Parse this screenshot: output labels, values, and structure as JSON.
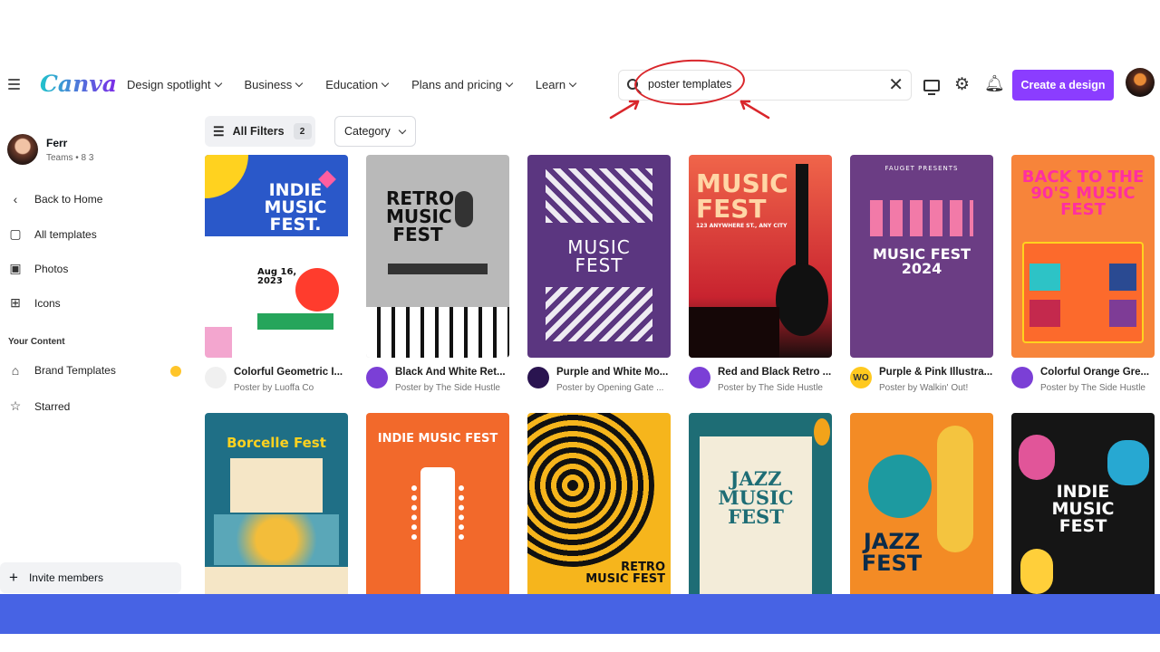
{
  "app": {
    "logo": "Canva"
  },
  "nav": [
    "Design spotlight",
    "Business",
    "Education",
    "Plans and pricing",
    "Learn"
  ],
  "search": {
    "value": "poster templates"
  },
  "header": {
    "create_label": "Create a design"
  },
  "user": {
    "name": "Ferr",
    "subtitle": "Teams • 8 3"
  },
  "sidebar": {
    "items": [
      "Back to Home",
      "All templates",
      "Photos",
      "Icons"
    ],
    "heading": "Your Content",
    "content_items": [
      "Brand Templates",
      "Starred"
    ],
    "invite_label": "Invite members"
  },
  "filters": {
    "all_label": "All Filters",
    "count": "2",
    "category_label": "Category"
  },
  "templates": [
    {
      "title": "Colorful Geometric I...",
      "sub": "Poster by Luoffa Co",
      "text": "INDIE MUSIC FEST.",
      "sub_text": "Aug 16, 2023"
    },
    {
      "title": "Black And White Ret...",
      "sub": "Poster by The Side Hustle",
      "text": "RETRO MUSIC FEST"
    },
    {
      "title": "Purple and White Mo...",
      "sub": "Poster by Opening Gate ...",
      "text": "MUSIC FEST"
    },
    {
      "title": "Red and Black Retro ...",
      "sub": "Poster by The Side Hustle",
      "text": "MUSIC FEST",
      "sub_text": "123 ANYWHERE ST., ANY CITY"
    },
    {
      "title": "Purple & Pink Illustra...",
      "sub": "Poster by Walkin' Out!",
      "text": "MUSIC FEST 2024",
      "sub_text": "FAUGET PRESENTS",
      "logo_text": "WO"
    },
    {
      "title": "Colorful Orange Gre...",
      "sub": "Poster by The Side Hustle",
      "text": "BACK TO THE 90'S MUSIC FEST"
    },
    {
      "title": "",
      "sub": "",
      "text": "Borcelle Fest"
    },
    {
      "title": "",
      "sub": "",
      "text": "INDIE MUSIC FEST"
    },
    {
      "title": "",
      "sub": "",
      "text": "RETRO MUSIC FEST"
    },
    {
      "title": "",
      "sub": "",
      "text": "JAZZ MUSIC FEST"
    },
    {
      "title": "",
      "sub": "",
      "text": "JAZZ FEST"
    },
    {
      "title": "",
      "sub": "",
      "text": "INDIE MUSIC FEST"
    }
  ],
  "colors": {
    "accent": "#8b3dff",
    "frame": "#4763e4",
    "annotation": "#d9262b"
  }
}
